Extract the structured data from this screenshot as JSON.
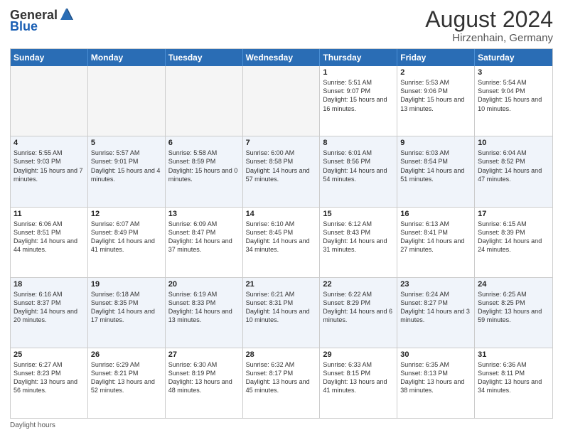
{
  "header": {
    "logo_general": "General",
    "logo_blue": "Blue",
    "title": "August 2024",
    "location": "Hirzenhain, Germany"
  },
  "days_of_week": [
    "Sunday",
    "Monday",
    "Tuesday",
    "Wednesday",
    "Thursday",
    "Friday",
    "Saturday"
  ],
  "weeks": [
    [
      {
        "day": "",
        "info": "",
        "empty": true
      },
      {
        "day": "",
        "info": "",
        "empty": true
      },
      {
        "day": "",
        "info": "",
        "empty": true
      },
      {
        "day": "",
        "info": "",
        "empty": true
      },
      {
        "day": "1",
        "info": "Sunrise: 5:51 AM\nSunset: 9:07 PM\nDaylight: 15 hours\nand 16 minutes.",
        "empty": false
      },
      {
        "day": "2",
        "info": "Sunrise: 5:53 AM\nSunset: 9:06 PM\nDaylight: 15 hours\nand 13 minutes.",
        "empty": false
      },
      {
        "day": "3",
        "info": "Sunrise: 5:54 AM\nSunset: 9:04 PM\nDaylight: 15 hours\nand 10 minutes.",
        "empty": false
      }
    ],
    [
      {
        "day": "4",
        "info": "Sunrise: 5:55 AM\nSunset: 9:03 PM\nDaylight: 15 hours\nand 7 minutes.",
        "empty": false
      },
      {
        "day": "5",
        "info": "Sunrise: 5:57 AM\nSunset: 9:01 PM\nDaylight: 15 hours\nand 4 minutes.",
        "empty": false
      },
      {
        "day": "6",
        "info": "Sunrise: 5:58 AM\nSunset: 8:59 PM\nDaylight: 15 hours\nand 0 minutes.",
        "empty": false
      },
      {
        "day": "7",
        "info": "Sunrise: 6:00 AM\nSunset: 8:58 PM\nDaylight: 14 hours\nand 57 minutes.",
        "empty": false
      },
      {
        "day": "8",
        "info": "Sunrise: 6:01 AM\nSunset: 8:56 PM\nDaylight: 14 hours\nand 54 minutes.",
        "empty": false
      },
      {
        "day": "9",
        "info": "Sunrise: 6:03 AM\nSunset: 8:54 PM\nDaylight: 14 hours\nand 51 minutes.",
        "empty": false
      },
      {
        "day": "10",
        "info": "Sunrise: 6:04 AM\nSunset: 8:52 PM\nDaylight: 14 hours\nand 47 minutes.",
        "empty": false
      }
    ],
    [
      {
        "day": "11",
        "info": "Sunrise: 6:06 AM\nSunset: 8:51 PM\nDaylight: 14 hours\nand 44 minutes.",
        "empty": false
      },
      {
        "day": "12",
        "info": "Sunrise: 6:07 AM\nSunset: 8:49 PM\nDaylight: 14 hours\nand 41 minutes.",
        "empty": false
      },
      {
        "day": "13",
        "info": "Sunrise: 6:09 AM\nSunset: 8:47 PM\nDaylight: 14 hours\nand 37 minutes.",
        "empty": false
      },
      {
        "day": "14",
        "info": "Sunrise: 6:10 AM\nSunset: 8:45 PM\nDaylight: 14 hours\nand 34 minutes.",
        "empty": false
      },
      {
        "day": "15",
        "info": "Sunrise: 6:12 AM\nSunset: 8:43 PM\nDaylight: 14 hours\nand 31 minutes.",
        "empty": false
      },
      {
        "day": "16",
        "info": "Sunrise: 6:13 AM\nSunset: 8:41 PM\nDaylight: 14 hours\nand 27 minutes.",
        "empty": false
      },
      {
        "day": "17",
        "info": "Sunrise: 6:15 AM\nSunset: 8:39 PM\nDaylight: 14 hours\nand 24 minutes.",
        "empty": false
      }
    ],
    [
      {
        "day": "18",
        "info": "Sunrise: 6:16 AM\nSunset: 8:37 PM\nDaylight: 14 hours\nand 20 minutes.",
        "empty": false
      },
      {
        "day": "19",
        "info": "Sunrise: 6:18 AM\nSunset: 8:35 PM\nDaylight: 14 hours\nand 17 minutes.",
        "empty": false
      },
      {
        "day": "20",
        "info": "Sunrise: 6:19 AM\nSunset: 8:33 PM\nDaylight: 14 hours\nand 13 minutes.",
        "empty": false
      },
      {
        "day": "21",
        "info": "Sunrise: 6:21 AM\nSunset: 8:31 PM\nDaylight: 14 hours\nand 10 minutes.",
        "empty": false
      },
      {
        "day": "22",
        "info": "Sunrise: 6:22 AM\nSunset: 8:29 PM\nDaylight: 14 hours\nand 6 minutes.",
        "empty": false
      },
      {
        "day": "23",
        "info": "Sunrise: 6:24 AM\nSunset: 8:27 PM\nDaylight: 14 hours\nand 3 minutes.",
        "empty": false
      },
      {
        "day": "24",
        "info": "Sunrise: 6:25 AM\nSunset: 8:25 PM\nDaylight: 13 hours\nand 59 minutes.",
        "empty": false
      }
    ],
    [
      {
        "day": "25",
        "info": "Sunrise: 6:27 AM\nSunset: 8:23 PM\nDaylight: 13 hours\nand 56 minutes.",
        "empty": false
      },
      {
        "day": "26",
        "info": "Sunrise: 6:29 AM\nSunset: 8:21 PM\nDaylight: 13 hours\nand 52 minutes.",
        "empty": false
      },
      {
        "day": "27",
        "info": "Sunrise: 6:30 AM\nSunset: 8:19 PM\nDaylight: 13 hours\nand 48 minutes.",
        "empty": false
      },
      {
        "day": "28",
        "info": "Sunrise: 6:32 AM\nSunset: 8:17 PM\nDaylight: 13 hours\nand 45 minutes.",
        "empty": false
      },
      {
        "day": "29",
        "info": "Sunrise: 6:33 AM\nSunset: 8:15 PM\nDaylight: 13 hours\nand 41 minutes.",
        "empty": false
      },
      {
        "day": "30",
        "info": "Sunrise: 6:35 AM\nSunset: 8:13 PM\nDaylight: 13 hours\nand 38 minutes.",
        "empty": false
      },
      {
        "day": "31",
        "info": "Sunrise: 6:36 AM\nSunset: 8:11 PM\nDaylight: 13 hours\nand 34 minutes.",
        "empty": false
      }
    ]
  ],
  "footer": "Daylight hours"
}
